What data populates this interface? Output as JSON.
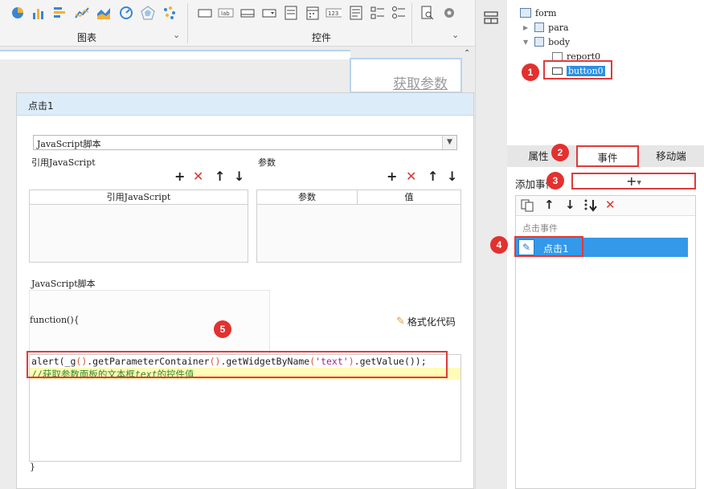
{
  "toolbar": {
    "chart_group_label": "图表",
    "widget_group_label": "控件",
    "chart_icons": [
      "pie-chart-icon",
      "bar-chart-icon",
      "horizontal-bar-icon",
      "line-chart-icon",
      "area-chart-icon",
      "gauge-icon",
      "radar-icon",
      "scatter-icon"
    ],
    "widget_icons": [
      "text-field-icon",
      "label-icon",
      "button-icon",
      "combo-icon",
      "list-icon",
      "date-icon",
      "number-icon",
      "textarea-icon",
      "checkbox-group-icon",
      "radio-group-icon",
      "search-icon",
      "settings-icon"
    ]
  },
  "canvas": {
    "widget_text": "获取参数"
  },
  "dialog": {
    "title": "点击1",
    "type_select": "JavaScript脚本",
    "ref_section_label": "引用JavaScript",
    "param_section_label": "参数",
    "ref_table_header": "引用JavaScript",
    "param_col_name": "参数",
    "param_col_value": "值",
    "script_section_label": "JavaScript脚本",
    "function_open": "function(){",
    "format_code_label": "格式化代码",
    "code_line1_prefix": "alert(_g",
    "code_line1_p1": "()",
    "code_line1_mid": ".getParameterContainer",
    "code_line1_p2": "()",
    "code_line1_mid2": ".getWidgetByName",
    "code_line1_p3": "(",
    "code_line1_str": "'text'",
    "code_line1_p4": ")",
    "code_line1_end": ".getValue());",
    "code_line2_prefix": "//获取参数面板的文本框",
    "code_line2_italic": "text",
    "code_line2_suffix": "的控件值",
    "function_close": "}"
  },
  "tree": {
    "form": "form",
    "para": "para",
    "body": "body",
    "report": "report0",
    "button": "button0"
  },
  "tabs": {
    "properties": "属性",
    "events": "事件",
    "mobile": "移动端"
  },
  "events_panel": {
    "add_event_label": "添加事件",
    "add_button": "+",
    "group_label": "点击事件",
    "event_item": "点击1"
  },
  "callouts": [
    "1",
    "2",
    "3",
    "4",
    "5"
  ],
  "colors": {
    "accent": "#2f8fe0",
    "callout": "#e2312f",
    "selection": "#3399e8"
  }
}
